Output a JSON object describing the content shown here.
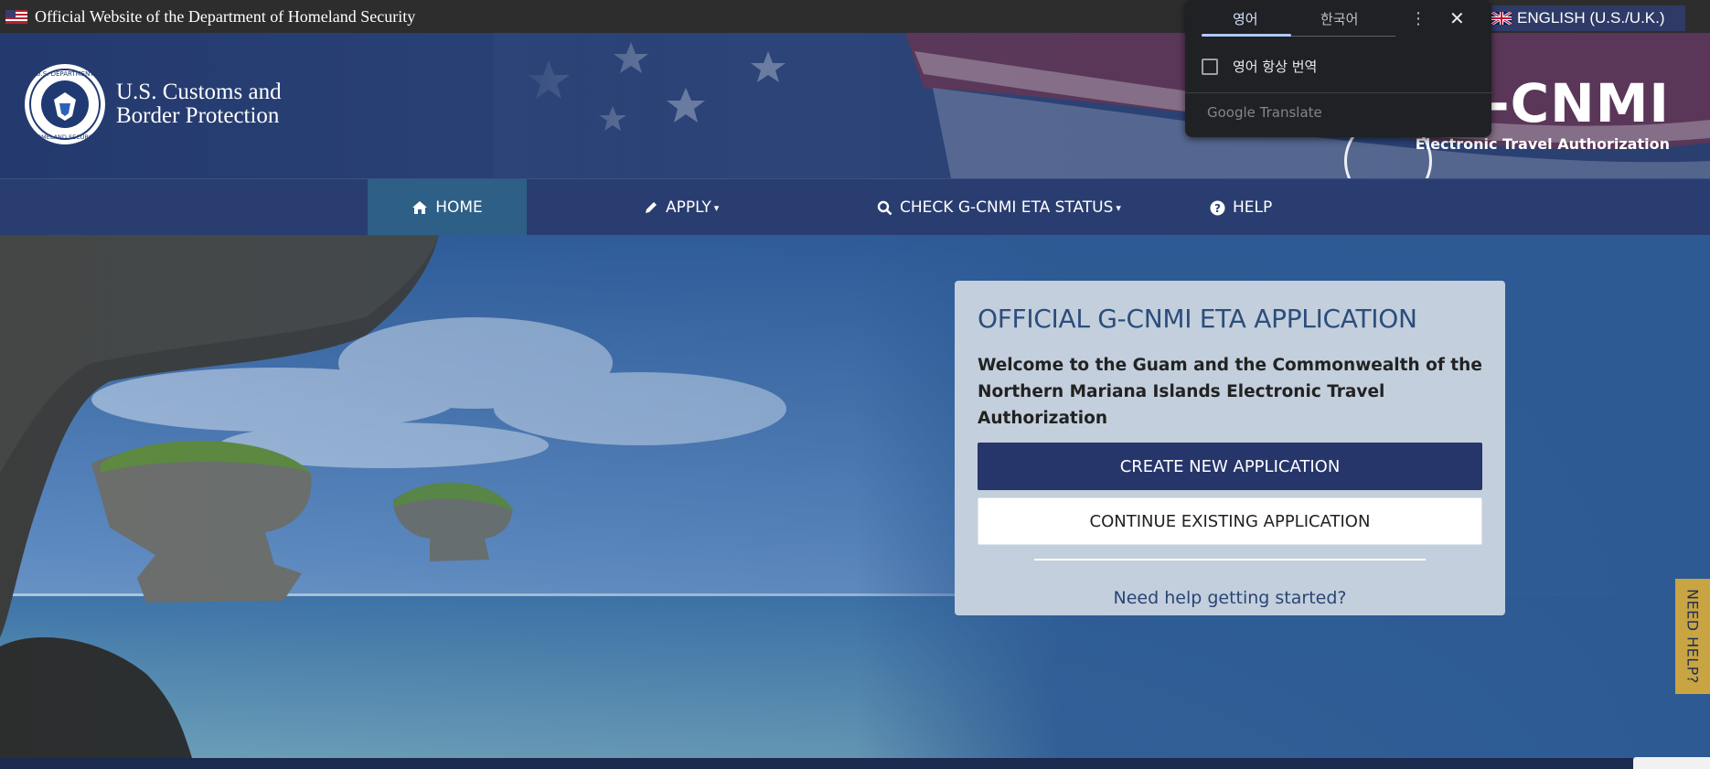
{
  "official_bar": {
    "text": "Official Website of the Department of Homeland Security"
  },
  "language_selector": {
    "label": "ENGLISH (U.S./U.K.)"
  },
  "header": {
    "agency_line1": "U.S. Customs and",
    "agency_line2": "Border Protection",
    "brand_title": "G-CNMI",
    "brand_subtitle": "Electronic Travel Authorization"
  },
  "nav": {
    "items": [
      {
        "label": "HOME",
        "icon": "home-icon",
        "active": true
      },
      {
        "label": "APPLY",
        "icon": "pencil-icon",
        "dropdown": true
      },
      {
        "label": "CHECK G-CNMI ETA STATUS",
        "icon": "search-icon",
        "dropdown": true
      },
      {
        "label": "HELP",
        "icon": "question-circle-icon"
      }
    ]
  },
  "card": {
    "title": "OFFICIAL G-CNMI ETA APPLICATION",
    "welcome": "Welcome to the Guam and the Commonwealth of the Northern Mariana Islands Electronic Travel Authorization",
    "create_button": "CREATE NEW APPLICATION",
    "continue_button": "CONTINUE EXISTING APPLICATION",
    "help_link": "Need help getting started?"
  },
  "need_help_tab": "NEED HELP?",
  "translate_popup": {
    "tab_source": "영어",
    "tab_target": "한국어",
    "always_translate": "영어 항상 번역",
    "footer": "Google Translate",
    "checked": false
  },
  "colors": {
    "header_bg": "#2c4478",
    "nav_bg": "#2a3d70",
    "nav_active": "#2e5f86",
    "primary_button": "#26356a",
    "card_bg": "#c3cfdc",
    "need_help_bg": "#c9a442"
  }
}
